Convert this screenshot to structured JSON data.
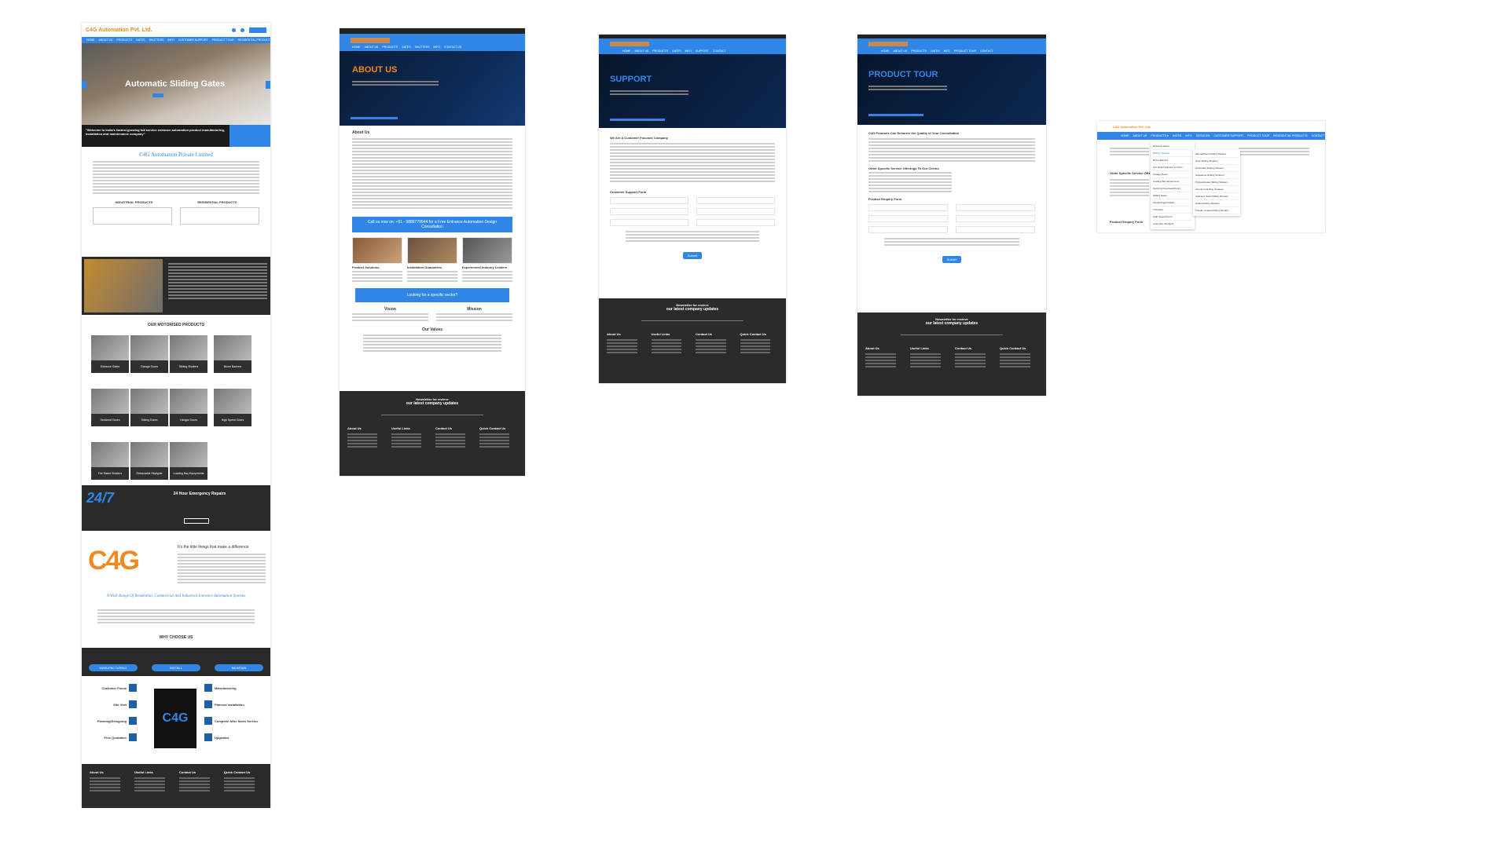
{
  "home": {
    "logo": "C4G Automation Pvt. Ltd.",
    "nav": [
      "HOME",
      "ABOUT US",
      "PRODUCTS",
      "GATES",
      "SHUTTERS",
      "INFO",
      "CUSTOMER SUPPORT",
      "PRODUCT TOUR",
      "RESIDENTIAL PRODUCTS",
      "CONTACT US"
    ],
    "hero_title": "Automatic Sliding Gates",
    "hero_quote": "\"Welcome to India's fastest growing full service entrance automation product manufacturing, installation and maintenance company\"",
    "company_title": "C4G Automation Private Limited",
    "industrial_label": "INDUSTRIAL PRODUCTS",
    "residential_label": "RESIDENTIAL PRODUCTS",
    "motorised_title": "OUR MOTORISED PRODUCTS",
    "products": [
      "Entrance Gates",
      "Garage Doors",
      "Sliding Shutters",
      "Boom Barriers",
      "Sectional Doors",
      "Sliding Doors",
      "Hangar Doors",
      "High Speed Doors",
      "Fire Rated Shutters",
      "Retractable Skylights",
      "Loading Bay Equipments"
    ],
    "emergency_title": "24 Hour Emergency Repairs",
    "emergency_badge": "24/7",
    "little_things": "It's the little things that make a difference.",
    "big_logo": "C4G",
    "range_title": "A Wide Range Of Residential, Commercial And Industrial Entrance Automation Systems",
    "why_title": "WHY CHOOSE US",
    "why_tabs": [
      "MANUFACTURING",
      "INSTALL",
      "MAINTAIN"
    ],
    "why_left": [
      "Customer Focus",
      "Site Visit",
      "Planning/Designing",
      "Free Quotation"
    ],
    "why_right": [
      "Manufacturing",
      "Planned Installation",
      "Complete After Sales Service",
      "Upgrades"
    ],
    "footer_cols": [
      "About Us",
      "Useful Links",
      "Contact Us",
      "Quick Contact Us"
    ]
  },
  "about": {
    "hero_title": "ABOUT US",
    "section_title": "About Us",
    "cta": "Call us now on: +91 - 9886779944 for a Free Entrance Automation Design Consultation",
    "cards": [
      "Product Solutions",
      "Installation Guarantees",
      "Experienced Industry Leaders"
    ],
    "sector_banner": "Looking for a specific sector?",
    "vision": "Vision",
    "mission": "Mission",
    "values": "Our Values",
    "newsletter_l1": "Newsletter for recieve",
    "newsletter_l2": "our latest company updates"
  },
  "support": {
    "hero_title": "SUPPORT",
    "section_title": "We Are A Customer Focused Company",
    "form_title": "Customer Support Form",
    "submit": "Submit",
    "newsletter_l1": "Newsletter for recieve",
    "newsletter_l2": "our latest company updates"
  },
  "tour": {
    "hero_title": "PRODUCT TOUR",
    "section_title": "C4G Products Can Enhance the Quality of Your Consultation",
    "offerings": "Other Specific Service Offerings To Our Clients",
    "enquiry": "Product Enquiry Form",
    "submit": "Submit",
    "newsletter_l1": "Newsletter for recieve",
    "newsletter_l2": "our latest company updates"
  },
  "menu": {
    "logo": "C4G Automation Pvt. Ltd.",
    "col1": [
      "Entrance Gates",
      "Sliding Shutters",
      "Boom Barriers",
      "Fire Rated Shutters & Doors",
      "Garage Doors",
      "Loading Bay Equipments",
      "Sectional Overhead Doors",
      "Sliding Gates",
      "Swing/Hinged Gates",
      "Turnstiles",
      "High Speed Doors",
      "Automatic Skylights"
    ],
    "col2": [
      "Manual/Sand Rolled Shutters",
      "Gear Sliding Shutters",
      "Perforated Rolling Shutters",
      "Galvalume Rolling Shutters",
      "Polycarbonate Sliding Shutters",
      "Aluminum Rolling Shutters",
      "Stainless Steel Rolling Shutters",
      "Grilled Rolling Shutters",
      "Powder Coated Rolling Shutters"
    ],
    "other_title": "Other Specific Service Offer",
    "enquiry": "Product Enquiry Form"
  }
}
